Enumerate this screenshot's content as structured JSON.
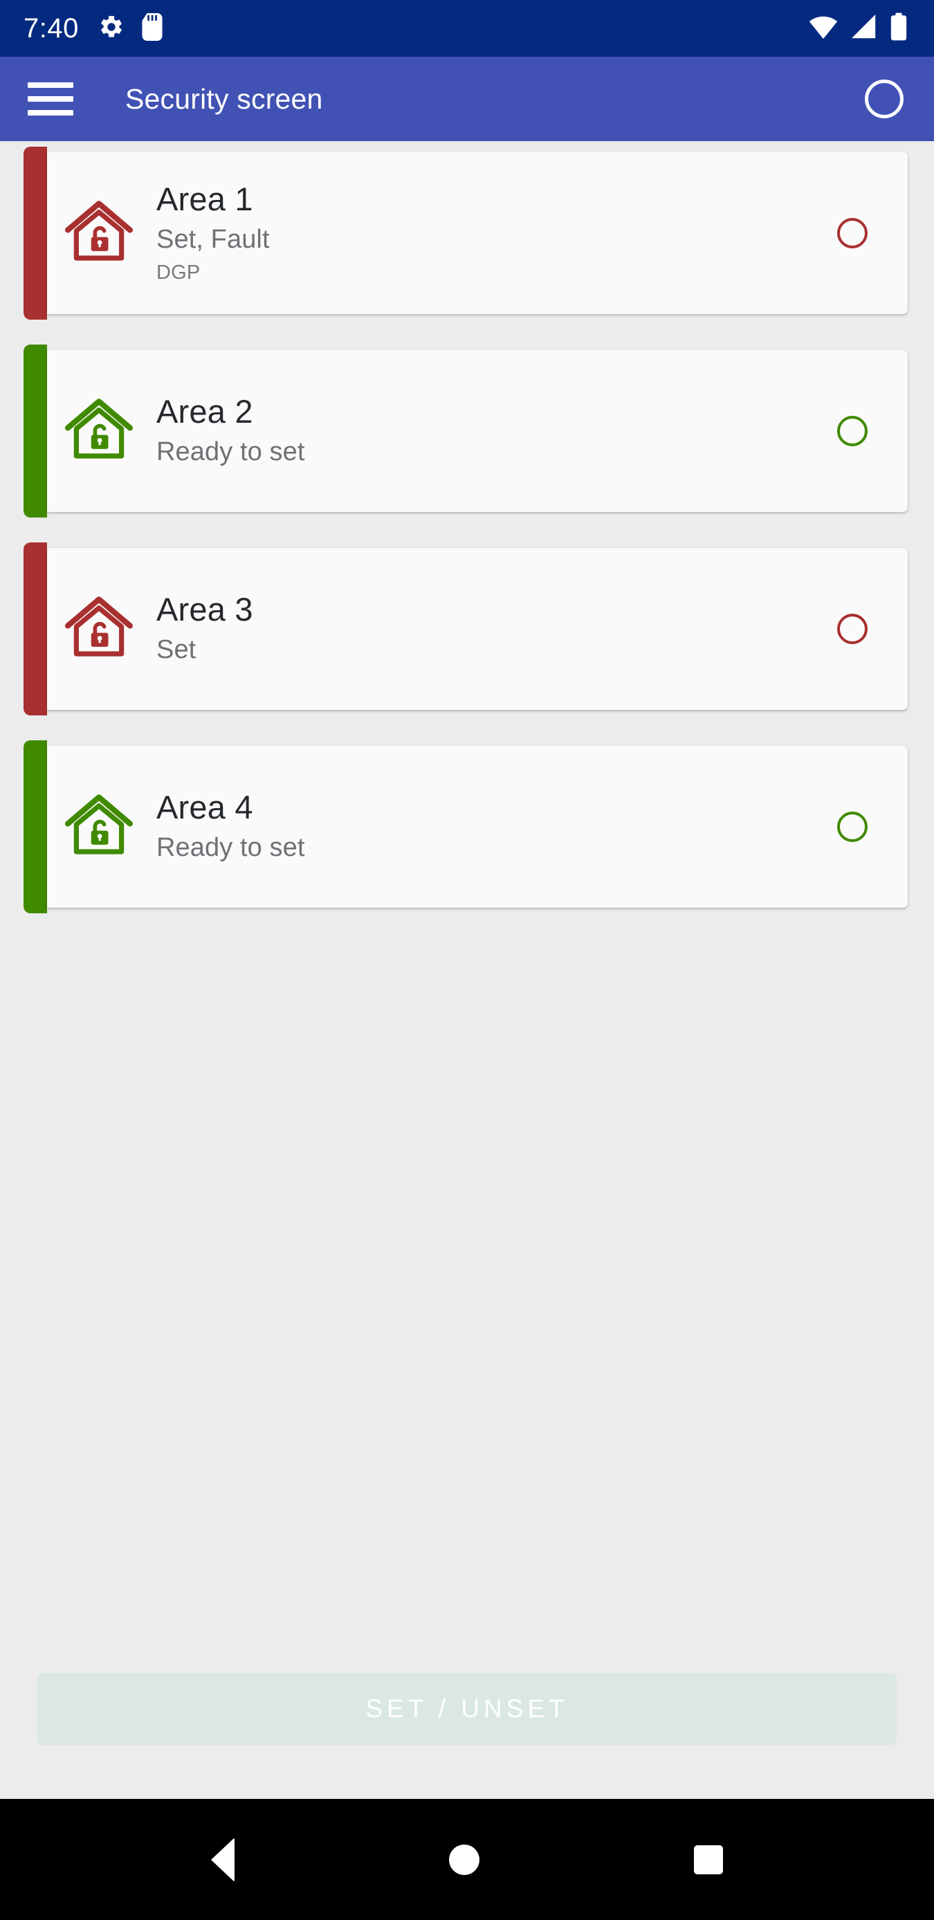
{
  "status_bar": {
    "time": "7:40",
    "left_icons": [
      "gear-icon",
      "sd-card-icon"
    ],
    "right_icons": [
      "wifi-icon",
      "cellular-signal-icon",
      "battery-icon"
    ],
    "background_color": "#042a80"
  },
  "app_bar": {
    "menu_icon": "hamburger-menu-icon",
    "title": "Security screen",
    "select_all_icon": "circle-outline-icon",
    "background_color": "#4152b4"
  },
  "colors": {
    "fault_red": "#a93030",
    "ready_green": "#408a00",
    "page_background": "#ececec",
    "card_background": "#fafafa",
    "button_disabled_bg": "#dbe7e5"
  },
  "areas": [
    {
      "title": "Area 1",
      "status": "Set, Fault",
      "extra": "DGP",
      "state_color": "#a93030",
      "icon": "house-unlocked-icon",
      "indicator": "circle-outline-icon"
    },
    {
      "title": "Area 2",
      "status": "Ready to set",
      "extra": "",
      "state_color": "#408a00",
      "icon": "house-unlocked-icon",
      "indicator": "circle-outline-icon"
    },
    {
      "title": "Area 3",
      "status": "Set",
      "extra": "",
      "state_color": "#a93030",
      "icon": "house-unlocked-icon",
      "indicator": "circle-outline-icon"
    },
    {
      "title": "Area 4",
      "status": "Ready to set",
      "extra": "",
      "state_color": "#408a00",
      "icon": "house-unlocked-icon",
      "indicator": "circle-outline-icon"
    }
  ],
  "bottom_action": {
    "label": "SET / UNSET",
    "enabled": false
  },
  "navigation_bar": {
    "back": "back-triangle-icon",
    "home": "home-circle-icon",
    "recents": "recents-square-icon"
  }
}
